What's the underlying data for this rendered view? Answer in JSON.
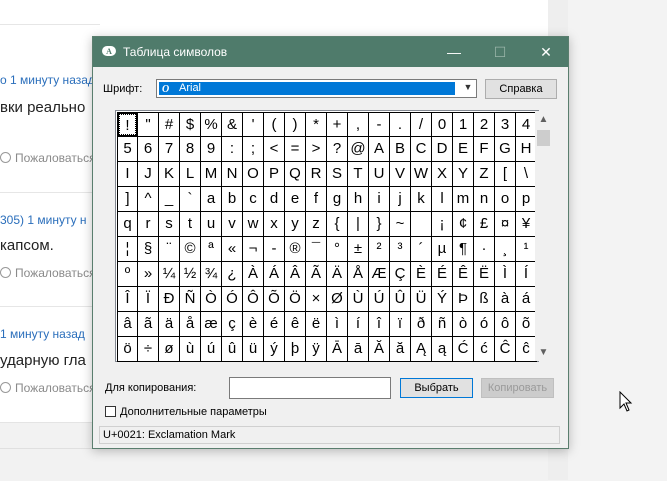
{
  "background": {
    "comments": [
      {
        "meta_prefix": "",
        "meta_time": "о 1 минуту назад",
        "text": "вки реально",
        "like_label": "Пожаловаться"
      },
      {
        "meta_prefix": "305)",
        "meta_time": "1 минуту н",
        "text": "капсом.",
        "like_label": "Пожаловаться"
      },
      {
        "meta_prefix": "",
        "meta_time": "1 минуту назад",
        "text": "ударную гла",
        "like_label": "Пожаловаться"
      }
    ]
  },
  "dialog": {
    "title": "Таблица символов",
    "controls": {
      "minimize": "—",
      "maximize": "☐",
      "close": "✕"
    },
    "font_label": "Шрифт:",
    "font_value": "Arial",
    "help_button": "Справка",
    "characters": [
      "!",
      "\"",
      "#",
      "$",
      "%",
      "&",
      "'",
      "(",
      ")",
      "*",
      "+",
      ",",
      "-",
      ".",
      "/",
      "0",
      "1",
      "2",
      "3",
      "4",
      "5",
      "6",
      "7",
      "8",
      "9",
      ":",
      ";",
      "<",
      "=",
      ">",
      "?",
      "@",
      "A",
      "B",
      "C",
      "D",
      "E",
      "F",
      "G",
      "H",
      "I",
      "J",
      "K",
      "L",
      "M",
      "N",
      "O",
      "P",
      "Q",
      "R",
      "S",
      "T",
      "U",
      "V",
      "W",
      "X",
      "Y",
      "Z",
      "[",
      "\\",
      "]",
      "^",
      "_",
      "`",
      "a",
      "b",
      "c",
      "d",
      "e",
      "f",
      "g",
      "h",
      "i",
      "j",
      "k",
      "l",
      "m",
      "n",
      "o",
      "p",
      "q",
      "r",
      "s",
      "t",
      "u",
      "v",
      "w",
      "x",
      "y",
      "z",
      "{",
      "|",
      "}",
      "~",
      " ",
      "¡",
      "¢",
      "£",
      "¤",
      "¥",
      "¦",
      "§",
      "¨",
      "©",
      "ª",
      "«",
      "¬",
      "-",
      "®",
      "¯",
      "°",
      "±",
      "²",
      "³",
      "´",
      "µ",
      "¶",
      "·",
      "¸",
      "¹",
      "º",
      "»",
      "¼",
      "½",
      "¾",
      "¿",
      "À",
      "Á",
      "Â",
      "Ã",
      "Ä",
      "Å",
      "Æ",
      "Ç",
      "È",
      "É",
      "Ê",
      "Ë",
      "Ì",
      "Í",
      "Î",
      "Ï",
      "Ð",
      "Ñ",
      "Ò",
      "Ó",
      "Ô",
      "Õ",
      "Ö",
      "×",
      "Ø",
      "Ù",
      "Ú",
      "Û",
      "Ü",
      "Ý",
      "Þ",
      "ß",
      "à",
      "á",
      "â",
      "ã",
      "ä",
      "å",
      "æ",
      "ç",
      "è",
      "é",
      "ê",
      "ë",
      "ì",
      "í",
      "î",
      "ï",
      "ð",
      "ñ",
      "ò",
      "ó",
      "ô",
      "õ",
      "ö",
      "÷",
      "ø",
      "ù",
      "ú",
      "û",
      "ü",
      "ý",
      "þ",
      "ÿ",
      "Ā",
      "ā",
      "Ă",
      "ă",
      "Ą",
      "ą",
      "Ć",
      "ć",
      "Ĉ",
      "ĉ"
    ],
    "selected_index": 0,
    "copy_label": "Для копирования:",
    "copy_value": "",
    "select_button": "Выбрать",
    "copy_button": "Копировать",
    "advanced_label": "Дополнительные параметры",
    "status": "U+0021: Exclamation Mark"
  }
}
